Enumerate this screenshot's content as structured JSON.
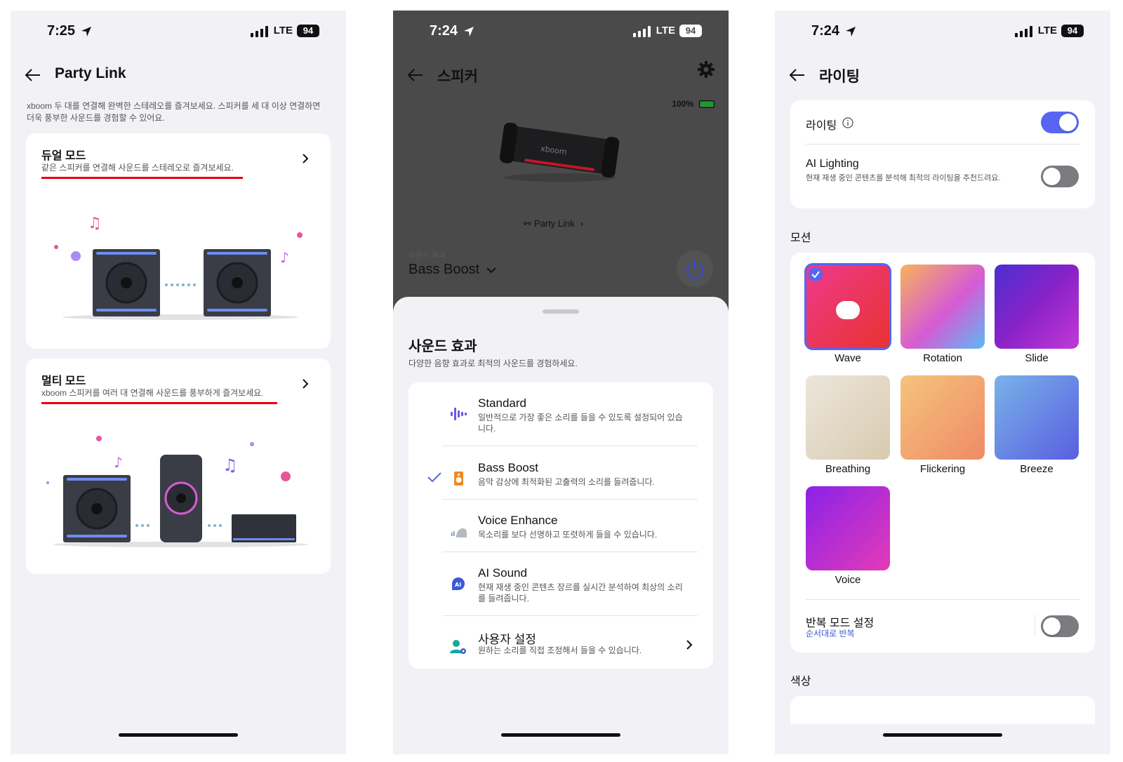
{
  "phone1": {
    "status": {
      "time": "7:25",
      "network": "LTE",
      "battery": "94"
    },
    "title": "Party Link",
    "intro": "xboom 두 대를 연결해 완벽한 스테레오를 즐겨보세요. 스피커를 세 대 이상 연결하면 더욱 풍부한 사운드를 경험할 수 있어요.",
    "dual": {
      "title": "듀얼 모드",
      "desc": "같은 스피커를 연결해 사운드를 스테레오로 즐겨보세요."
    },
    "multi": {
      "title": "멀티 모드",
      "desc": "xboom 스피커를 여러 대 연결해 사운드를 풍부하게 즐겨보세요."
    }
  },
  "phone2": {
    "status": {
      "time": "7:24",
      "network": "LTE",
      "battery": "94"
    },
    "title": "스피커",
    "battery_pct": "100%",
    "speaker_brand": "xboom",
    "party_link": "Party Link",
    "effect_label": "사운드 효과",
    "effect_value": "Bass Boost",
    "sheet": {
      "title": "사운드 효과",
      "subtitle": "다양한 음향 효과로 최적의 사운드를 경험하세요.",
      "items": [
        {
          "title": "Standard",
          "desc": "일반적으로 가장 좋은 소리를 들을 수 있도록 설정되어 있습니다.",
          "icon": "waveform-icon",
          "selected": false
        },
        {
          "title": "Bass Boost",
          "desc": "음악 감상에 최적화된 고출력의 소리를 들려줍니다.",
          "icon": "speaker-icon",
          "selected": true
        },
        {
          "title": "Voice Enhance",
          "desc": "목소리를 보다 선명하고 또렷하게 들을 수 있습니다.",
          "icon": "voice-icon",
          "selected": false
        },
        {
          "title": "AI Sound",
          "desc": "현재 재생 중인 콘텐츠 장르를 실시간 분석하여 최상의 소리를 들려줍니다.",
          "icon": "ai-icon",
          "selected": false
        },
        {
          "title": "사용자 설정",
          "desc": "원하는 소리를 직접 조정해서 들을 수 있습니다.",
          "icon": "user-settings-icon",
          "selected": false
        }
      ]
    }
  },
  "phone3": {
    "status": {
      "time": "7:24",
      "network": "LTE",
      "battery": "94"
    },
    "title": "라이팅",
    "lighting": {
      "label": "라이팅",
      "on": true
    },
    "ai_lighting": {
      "label": "AI Lighting",
      "desc": "현재 재생 중인 콘텐츠를 분석해 최적의 라이팅을 추천드려요.",
      "on": false
    },
    "motion_header": "모션",
    "motions": [
      {
        "label": "Wave",
        "selected": true,
        "color_a": "#ee3a8c",
        "color_b": "#e8322f"
      },
      {
        "label": "Rotation",
        "selected": false,
        "color_a": "#f7b35a",
        "color_b": "#7a6cf5"
      },
      {
        "label": "Slide",
        "selected": false,
        "color_a": "#4a2fd0",
        "color_b": "#c23ad6"
      },
      {
        "label": "Breathing",
        "selected": false,
        "color_a": "#ece6db",
        "color_b": "#d8cab0"
      },
      {
        "label": "Flickering",
        "selected": false,
        "color_a": "#f4c47c",
        "color_b": "#f08a66"
      },
      {
        "label": "Breeze",
        "selected": false,
        "color_a": "#78b3e8",
        "color_b": "#5a5ee0"
      },
      {
        "label": "Voice",
        "selected": false,
        "color_a": "#8a22e8",
        "color_b": "#e43ab8"
      }
    ],
    "repeat": {
      "label": "반복 모드 설정",
      "sub": "순서대로 반복",
      "on": false
    },
    "color_header": "색상",
    "colors": {
      "accent": "#5865f2",
      "toggle_off": "#7b7b80"
    }
  }
}
